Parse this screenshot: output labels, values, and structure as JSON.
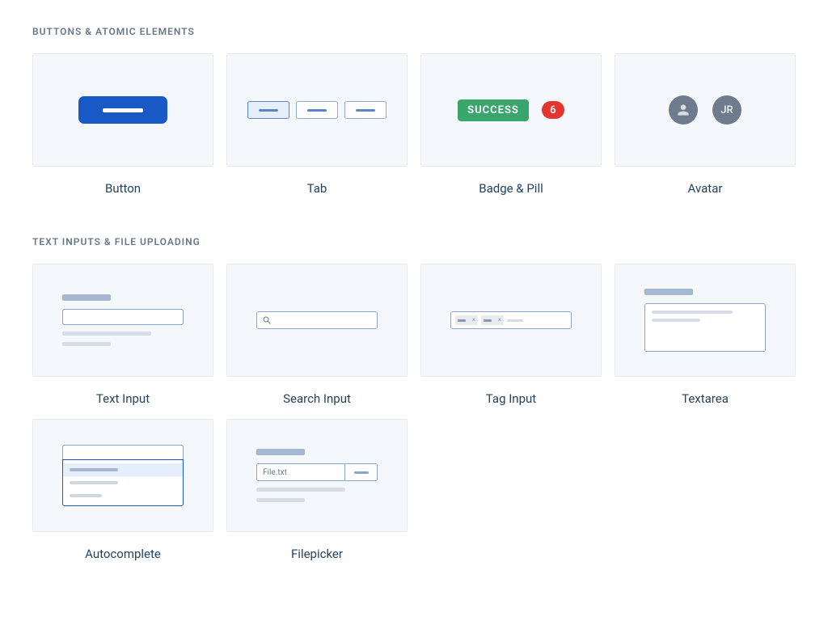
{
  "sections": {
    "buttons": {
      "title": "BUTTONS & ATOMIC ELEMENTS",
      "items": {
        "button": {
          "label": "Button"
        },
        "tab": {
          "label": "Tab"
        },
        "badge": {
          "label": "Badge & Pill",
          "badge_text": "SUCCESS",
          "pill_text": "6"
        },
        "avatar": {
          "label": "Avatar",
          "initials": "JR"
        }
      }
    },
    "inputs": {
      "title": "TEXT INPUTS & FILE UPLOADING",
      "items": {
        "text_input": {
          "label": "Text Input"
        },
        "search_input": {
          "label": "Search Input"
        },
        "tag_input": {
          "label": "Tag Input"
        },
        "textarea": {
          "label": "Textarea"
        },
        "autocomplete": {
          "label": "Autocomplete"
        },
        "filepicker": {
          "label": "Filepicker",
          "filename": "File.txt"
        }
      }
    }
  },
  "colors": {
    "primary": "#1859c5",
    "success": "#3aa56d",
    "danger": "#e3342f",
    "muted": "#66788a"
  }
}
